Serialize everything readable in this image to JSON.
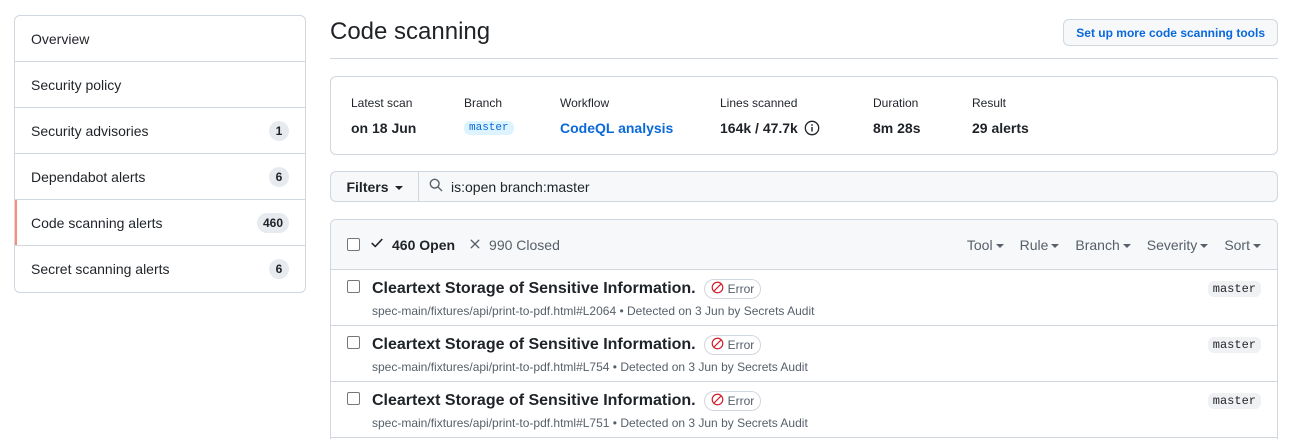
{
  "sidebar": {
    "items": [
      {
        "label": "Overview",
        "count": null,
        "active": false
      },
      {
        "label": "Security policy",
        "count": null,
        "active": false
      },
      {
        "label": "Security advisories",
        "count": "1",
        "active": false
      },
      {
        "label": "Dependabot alerts",
        "count": "6",
        "active": false
      },
      {
        "label": "Code scanning alerts",
        "count": "460",
        "active": true
      },
      {
        "label": "Secret scanning alerts",
        "count": "6",
        "active": false
      }
    ]
  },
  "header": {
    "title": "Code scanning",
    "setup_button": "Set up more code scanning tools"
  },
  "summary": {
    "latest_scan": {
      "label": "Latest scan",
      "value": "on 18 Jun"
    },
    "branch": {
      "label": "Branch",
      "value": "master"
    },
    "workflow": {
      "label": "Workflow",
      "value": "CodeQL analysis"
    },
    "lines": {
      "label": "Lines scanned",
      "value": "164k / 47.7k"
    },
    "duration": {
      "label": "Duration",
      "value": "8m 28s"
    },
    "result": {
      "label": "Result",
      "value": "29 alerts"
    }
  },
  "filter": {
    "button": "Filters",
    "query": "is:open branch:master"
  },
  "list": {
    "open_label": "460 Open",
    "closed_label": "990 Closed",
    "sorts": [
      "Tool",
      "Rule",
      "Branch",
      "Severity",
      "Sort"
    ],
    "alerts": [
      {
        "title": "Cleartext Storage of Sensitive Information.",
        "severity": "Error",
        "path": "spec-main/fixtures/api/print-to-pdf.html#L2064",
        "detected": "• Detected on 3 Jun by Secrets Audit",
        "branch": "master"
      },
      {
        "title": "Cleartext Storage of Sensitive Information.",
        "severity": "Error",
        "path": "spec-main/fixtures/api/print-to-pdf.html#L754",
        "detected": "• Detected on 3 Jun by Secrets Audit",
        "branch": "master"
      },
      {
        "title": "Cleartext Storage of Sensitive Information.",
        "severity": "Error",
        "path": "spec-main/fixtures/api/print-to-pdf.html#L751",
        "detected": "• Detected on 3 Jun by Secrets Audit",
        "branch": "master"
      }
    ]
  },
  "colors": {
    "accent": "#0969da",
    "active_marker": "#fd8c73",
    "error": "#cf222e"
  }
}
